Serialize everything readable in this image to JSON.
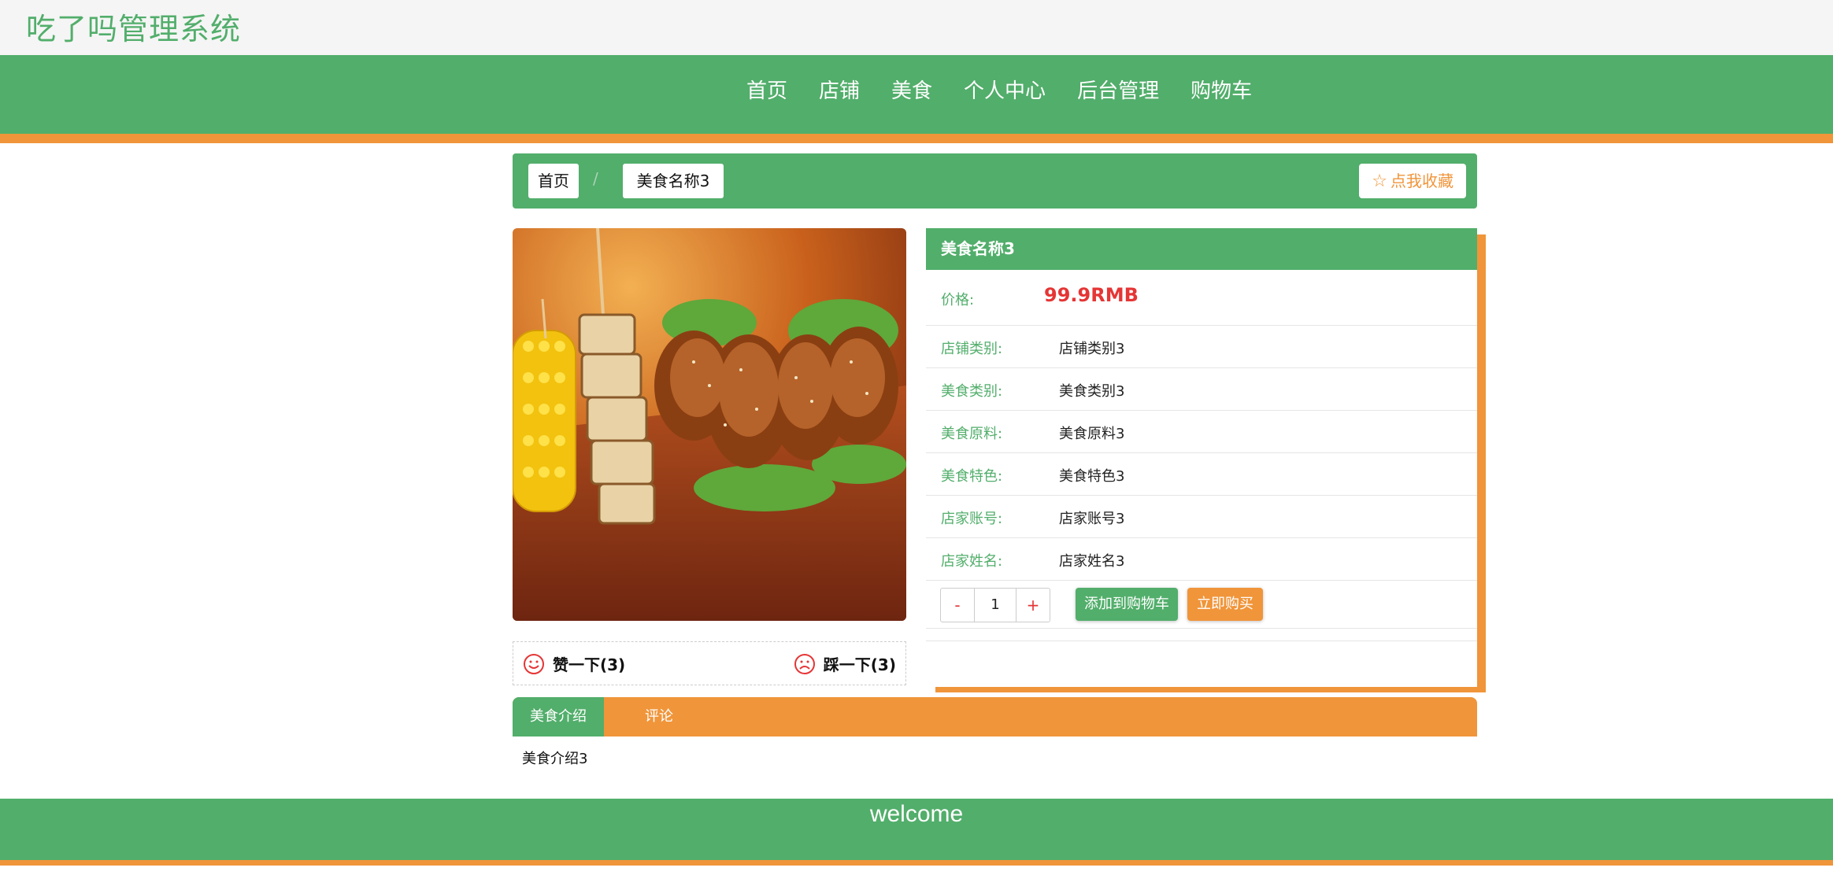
{
  "site_title": "吃了吗管理系统",
  "nav": [
    "首页",
    "店铺",
    "美食",
    "个人中心",
    "后台管理",
    "购物车"
  ],
  "breadcrumb": {
    "home": "首页",
    "separator": "/",
    "current": "美食名称3"
  },
  "favorite_label": "点我收藏",
  "image_alt": "美食名称3",
  "vote": {
    "up_label": "赞一下(3)",
    "down_label": "踩一下(3)"
  },
  "detail": {
    "name": "美食名称3",
    "price_label": "价格:",
    "price": "99.9RMB",
    "fields": [
      {
        "label": "店铺类别:",
        "value": "店铺类别3"
      },
      {
        "label": "美食类别:",
        "value": "美食类别3"
      },
      {
        "label": "美食原料:",
        "value": "美食原料3"
      },
      {
        "label": "美食特色:",
        "value": "美食特色3"
      },
      {
        "label": "店家账号:",
        "value": "店家账号3"
      },
      {
        "label": "店家姓名:",
        "value": "店家姓名3"
      }
    ],
    "quantity": "1",
    "minus": "-",
    "plus": "+",
    "add_to_cart": "添加到购物车",
    "buy_now": "立即购买"
  },
  "tabs": [
    "美食介绍",
    "评论"
  ],
  "tab_content": "美食介绍3",
  "footer_text": "welcome",
  "colors": {
    "primary": "#52ae6b",
    "accent": "#f0953a",
    "price": "#e53535",
    "topbar": "#f5f5f5"
  }
}
